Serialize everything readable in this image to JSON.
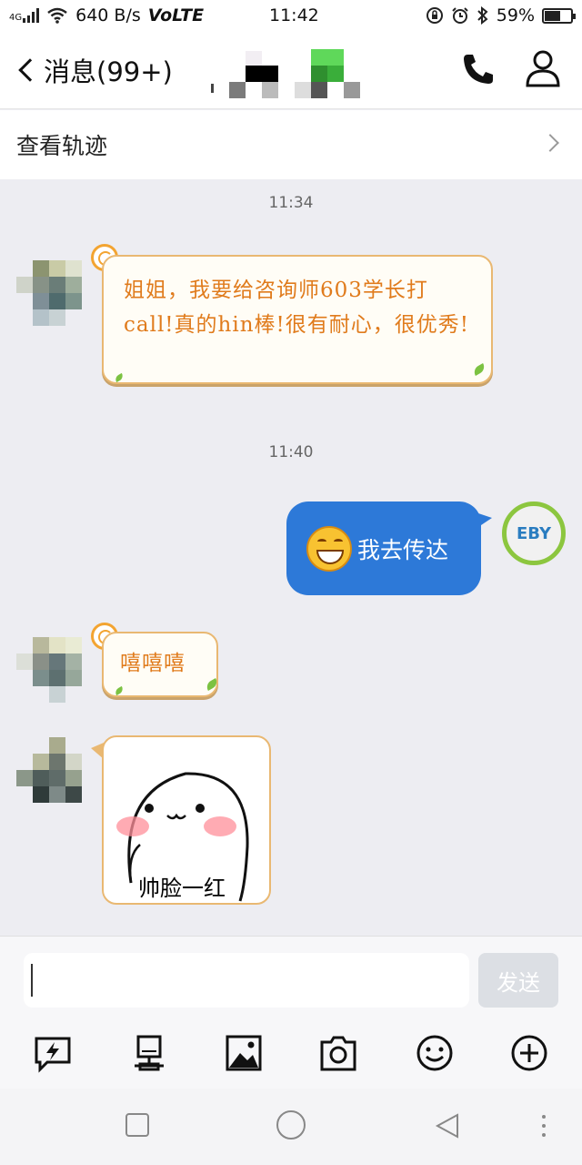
{
  "status_bar": {
    "network_type": "4G",
    "speed": "640 B/s",
    "volte": "VoLTE",
    "time": "11:42",
    "battery_pct": "59%",
    "battery_level": 0.59
  },
  "header": {
    "back_label": "消息(99+)"
  },
  "track_row": {
    "label": "查看轨迹"
  },
  "timestamps": [
    "11:34",
    "11:40"
  ],
  "messages": [
    {
      "side": "left",
      "type": "text",
      "text": "姐姐，我要给咨询师603学长打call!真的hin棒!很有耐心，很优秀!"
    },
    {
      "side": "right",
      "type": "text",
      "emoji": "grin-emoji",
      "text": "我去传达"
    },
    {
      "side": "left",
      "type": "text",
      "text": "嘻嘻嘻"
    },
    {
      "side": "left",
      "type": "sticker",
      "caption": "帅脸一红"
    }
  ],
  "my_avatar": {
    "logo_text": "EBY"
  },
  "composer": {
    "placeholder": "",
    "send_label": "发送"
  },
  "toolbar_icons": [
    "flash-photo-icon",
    "computer-icon",
    "image-icon",
    "camera-icon",
    "smiley-icon",
    "plus-circle-icon"
  ],
  "nav_icons": [
    "recent-apps-icon",
    "home-icon",
    "back-triangle-icon",
    "more-icon"
  ],
  "colors": {
    "blue_bubble": "#2d79d8",
    "sun_text": "#e07b1c",
    "sun_border": "#e9b872",
    "avatar_ring": "#8cc63f"
  }
}
